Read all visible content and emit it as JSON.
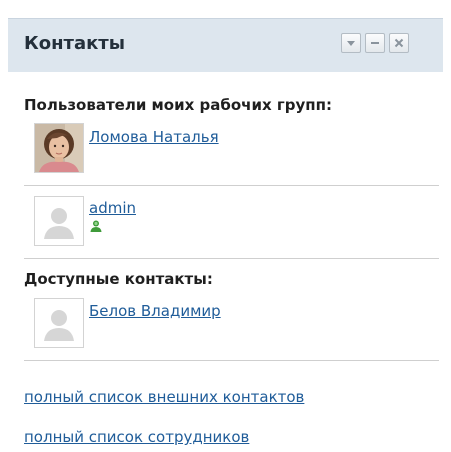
{
  "widget": {
    "title": "Контакты",
    "buttons": {
      "dropdown": "chevron-down-icon",
      "minimize": "minimize-icon",
      "close": "close-icon"
    }
  },
  "sections": {
    "workgroups_title": "Пользователи моих рабочих групп:",
    "available_title": "Доступные контакты:"
  },
  "contacts": {
    "lomova": {
      "name": "Ломова Наталья",
      "avatar": "user-photo"
    },
    "admin": {
      "name": "admin",
      "avatar": "default-avatar-icon",
      "status_icon": "online-user-icon"
    },
    "belov": {
      "name": "Белов Владимир",
      "avatar": "default-avatar-icon"
    }
  },
  "footer": {
    "external_contacts_link": "полный список внешних контактов",
    "employees_link": "полный список сотрудников"
  },
  "colors": {
    "header_bg": "#dde6ee",
    "link": "#1f5c99",
    "divider": "#cfcfcf"
  }
}
